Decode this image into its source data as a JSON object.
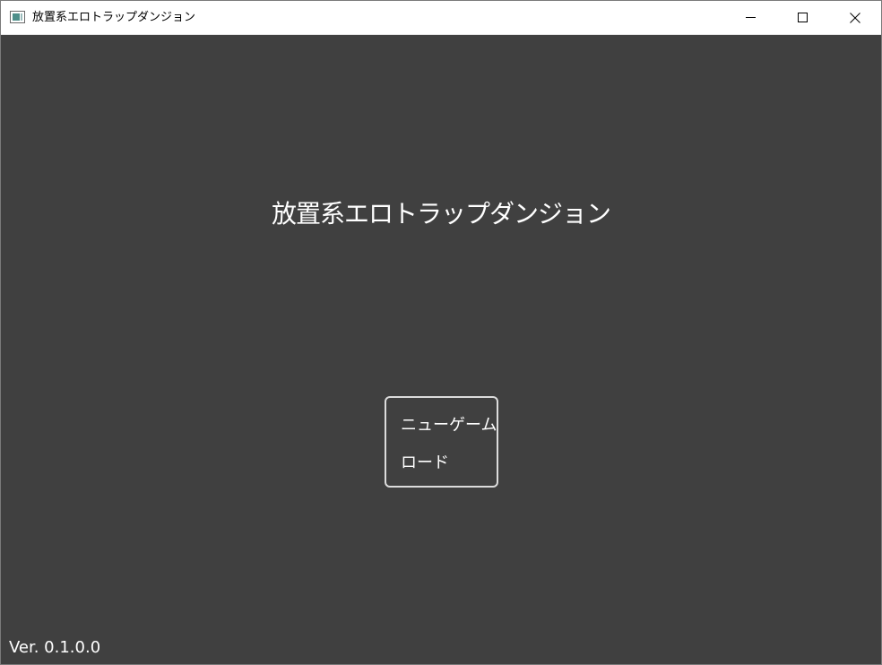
{
  "window": {
    "title": "放置系エロトラップダンジョン",
    "icon": "app-window-icon",
    "controls": [
      "minimize-icon",
      "maximize-icon",
      "close-icon"
    ]
  },
  "screen": {
    "game_title": "放置系エロトラップダンジョン",
    "menu": {
      "new_game": "ニューゲーム",
      "load": "ロード"
    },
    "version": "Ver. 0.1.0.0"
  },
  "colors": {
    "background": "#404040",
    "text": "#ffffff",
    "menu_border": "#dcdcdc",
    "titlebar": "#ffffff"
  }
}
